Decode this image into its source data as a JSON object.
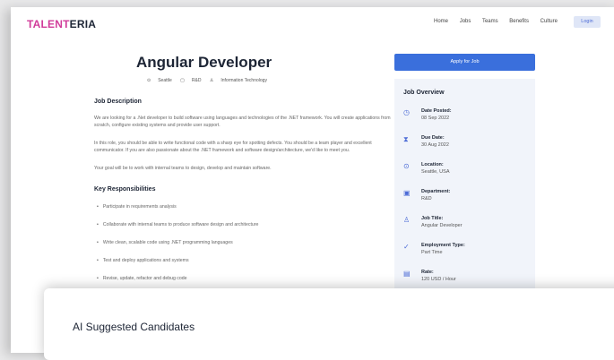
{
  "brand": {
    "part1": "TALENT",
    "part2": "ERIA"
  },
  "nav": {
    "items": [
      "Home",
      "Jobs",
      "Teams",
      "Benefits",
      "Culture"
    ],
    "login": "Login"
  },
  "job": {
    "title": "Angular Developer",
    "meta": [
      "Seattle",
      "R&D",
      "Information Technology"
    ],
    "desc_heading": "Job Description",
    "paragraphs": [
      "We are looking for a .Net developer to build software using languages and technologies of the .NET framework. You will create applications from scratch, configure existing systems and provide user support.",
      "In this role, you should be able to write functional code with a sharp eye for spotting defects. You should be a team player and excellent communicator. If you are also passionate about the .NET framework and software design/architecture, we'd like to meet you.",
      "Your goal will be to work with internal teams to design, develop and maintain software."
    ],
    "resp_heading": "Key Responsibilities",
    "responsibilities": [
      "Participate in requirements analysis",
      "Collaborate with internal teams to produce software design and architecture",
      "Write clean, scalable code using .NET programming languages",
      "Test and deploy applications and systems",
      "Revise, update, refactor and debug code"
    ]
  },
  "apply_label": "Apply for Job",
  "overview": {
    "heading": "Job Overview",
    "items": [
      {
        "icon": "clock-icon",
        "label": "Date Posted:",
        "value": "08 Sep 2022"
      },
      {
        "icon": "hourglass-icon",
        "label": "Due Date:",
        "value": "30 Aug 2022"
      },
      {
        "icon": "location-icon",
        "label": "Location:",
        "value": "Seattle, USA"
      },
      {
        "icon": "briefcase-icon",
        "label": "Department:",
        "value": "R&D"
      },
      {
        "icon": "user-icon",
        "label": "Job Title:",
        "value": "Angular Developer"
      },
      {
        "icon": "check-icon",
        "label": "Employment Type:",
        "value": "Part Time"
      },
      {
        "icon": "money-icon",
        "label": "Rate:",
        "value": "120 USD / Hour"
      }
    ]
  },
  "ai_panel": {
    "title": "AI Suggested Candidates"
  }
}
